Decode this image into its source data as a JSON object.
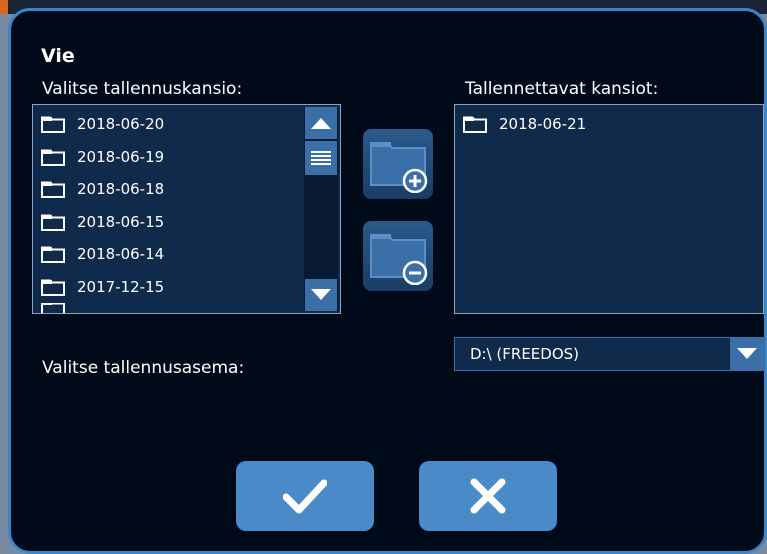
{
  "dialog": {
    "title": "Vie",
    "source_label": "Valitse tallennuskansio:",
    "target_label": "Tallennettavat kansiot:",
    "drive_label": "Valitse tallennusasema:"
  },
  "source_folders": [
    "2018-06-20",
    "2018-06-19",
    "2018-06-18",
    "2018-06-15",
    "2018-06-14",
    "2017-12-15"
  ],
  "target_folders": [
    "2018-06-21"
  ],
  "drive": {
    "selected": "D:\\ (FREEDOS)"
  },
  "icons": {
    "folder": "folder-icon",
    "add": "add-folder-icon",
    "remove": "remove-folder-icon",
    "ok": "checkmark-icon",
    "cancel": "x-icon",
    "dropdown": "chevron-down-icon"
  },
  "colors": {
    "background": "#000a18",
    "border": "#3c86c8",
    "list_bg": "#0f2a4a",
    "button": "#4a8ac8"
  }
}
